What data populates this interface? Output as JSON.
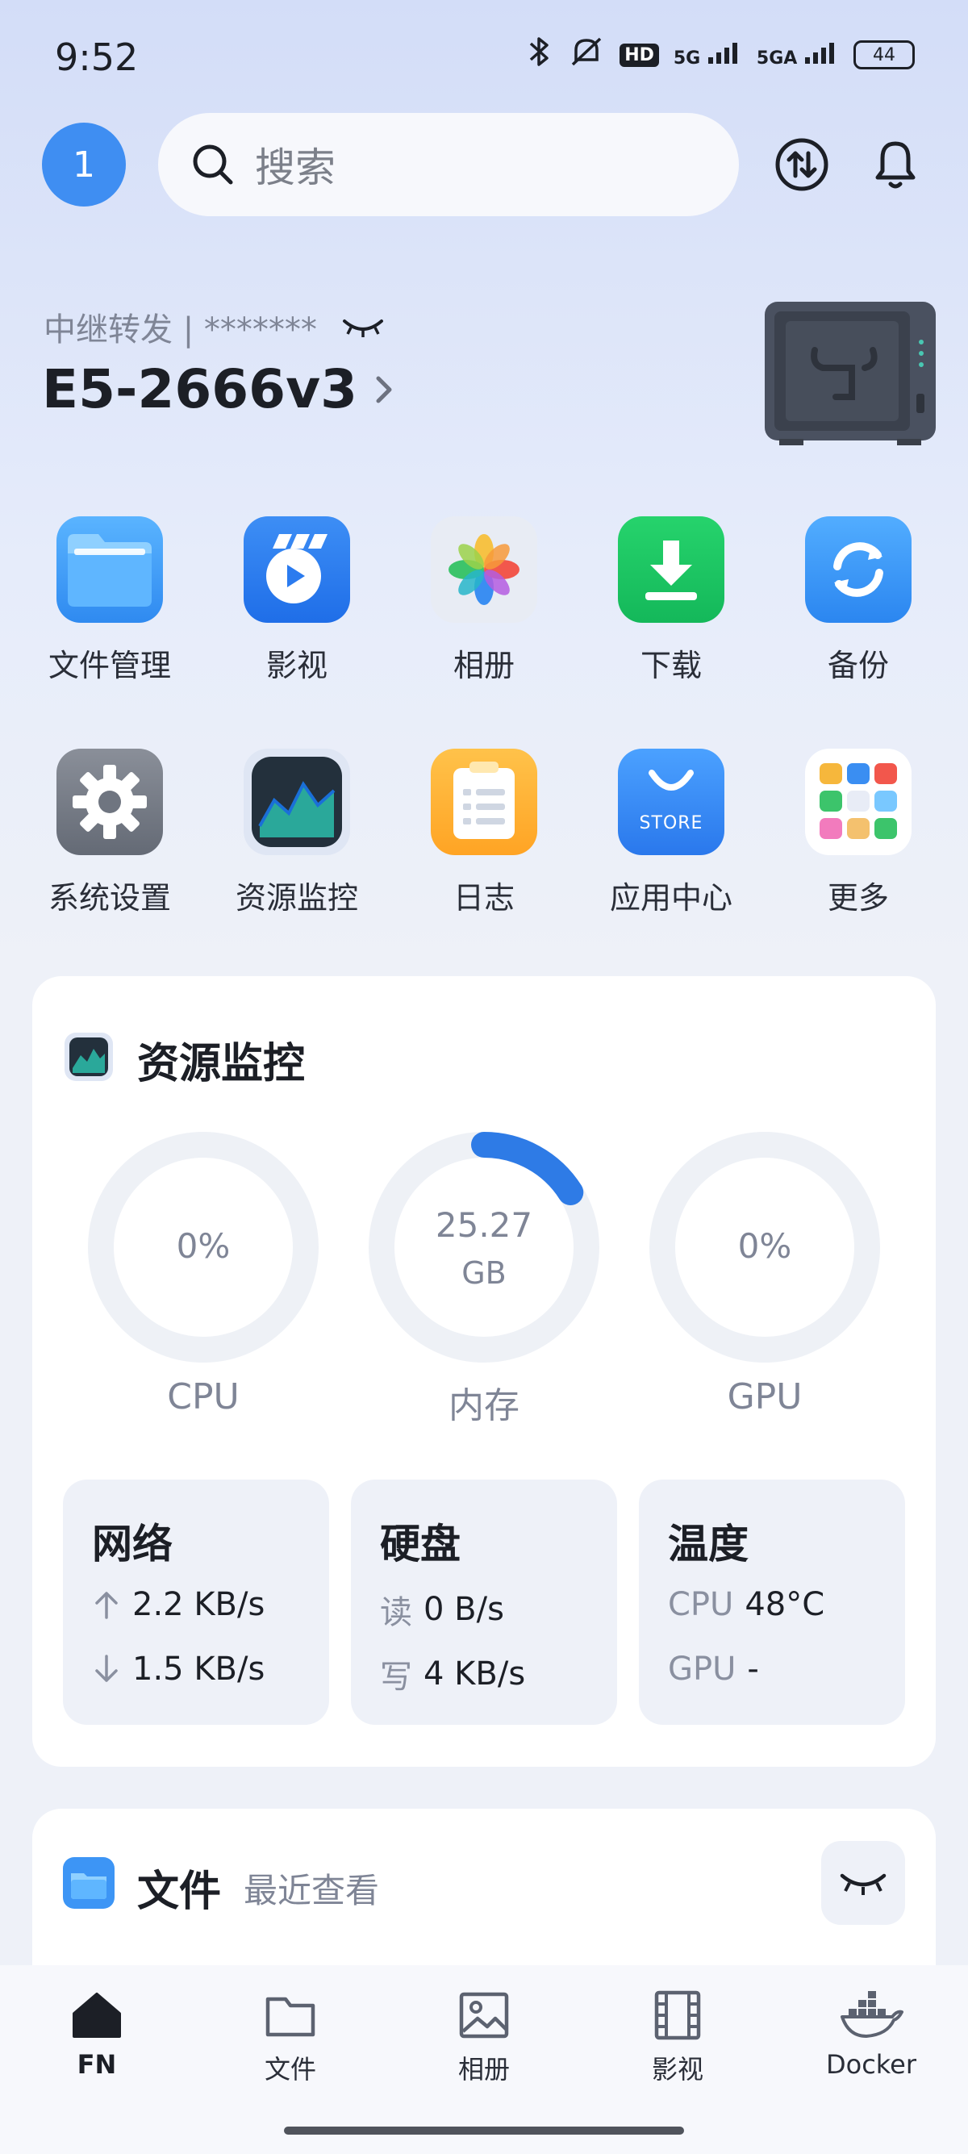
{
  "status_bar": {
    "time": "9:52",
    "signal_a": "5G",
    "signal_b": "5GA",
    "hd": "HD",
    "battery": "44"
  },
  "header": {
    "avatar_text": "1",
    "search_placeholder": "搜索"
  },
  "device": {
    "relay_label": "中继转发 | *******",
    "name": "E5-2666v3"
  },
  "apps_row1": [
    {
      "label": "文件管理",
      "icon": "folder-icon"
    },
    {
      "label": "影视",
      "icon": "film-icon"
    },
    {
      "label": "相册",
      "icon": "photos-icon"
    },
    {
      "label": "下载",
      "icon": "download-icon"
    },
    {
      "label": "备份",
      "icon": "backup-icon"
    }
  ],
  "apps_row2": [
    {
      "label": "系统设置",
      "icon": "gear-icon"
    },
    {
      "label": "资源监控",
      "icon": "monitor-icon"
    },
    {
      "label": "日志",
      "icon": "log-icon"
    },
    {
      "label": "应用中心",
      "icon": "store-icon",
      "badge": "STORE"
    },
    {
      "label": "更多",
      "icon": "more-icon"
    }
  ],
  "monitor": {
    "title": "资源监控",
    "gauges": [
      {
        "label": "CPU",
        "value": "0%",
        "fraction": 0
      },
      {
        "label": "内存",
        "value": "25.27",
        "unit": "GB",
        "fraction": 0.16
      },
      {
        "label": "GPU",
        "value": "0%",
        "fraction": 0
      }
    ],
    "network": {
      "title": "网络",
      "up": "2.2 KB/s",
      "down": "1.5 KB/s"
    },
    "disk": {
      "title": "硬盘",
      "read_label": "读",
      "read": "0 B/s",
      "write_label": "写",
      "write": "4 KB/s"
    },
    "temp": {
      "title": "温度",
      "cpu_label": "CPU",
      "cpu": "48°C",
      "gpu_label": "GPU",
      "gpu": "-"
    }
  },
  "files": {
    "title": "文件",
    "subtitle": "最近查看"
  },
  "bottom_nav": [
    {
      "label": "FN",
      "icon": "home-icon",
      "active": true
    },
    {
      "label": "文件",
      "icon": "folder-icon"
    },
    {
      "label": "相册",
      "icon": "image-icon"
    },
    {
      "label": "影视",
      "icon": "film-icon"
    },
    {
      "label": "Docker",
      "icon": "docker-icon"
    }
  ],
  "colors": {
    "accent": "#3f8ef2",
    "gauge_fill": "#2e7be6",
    "gauge_track": "#eef1f6"
  }
}
